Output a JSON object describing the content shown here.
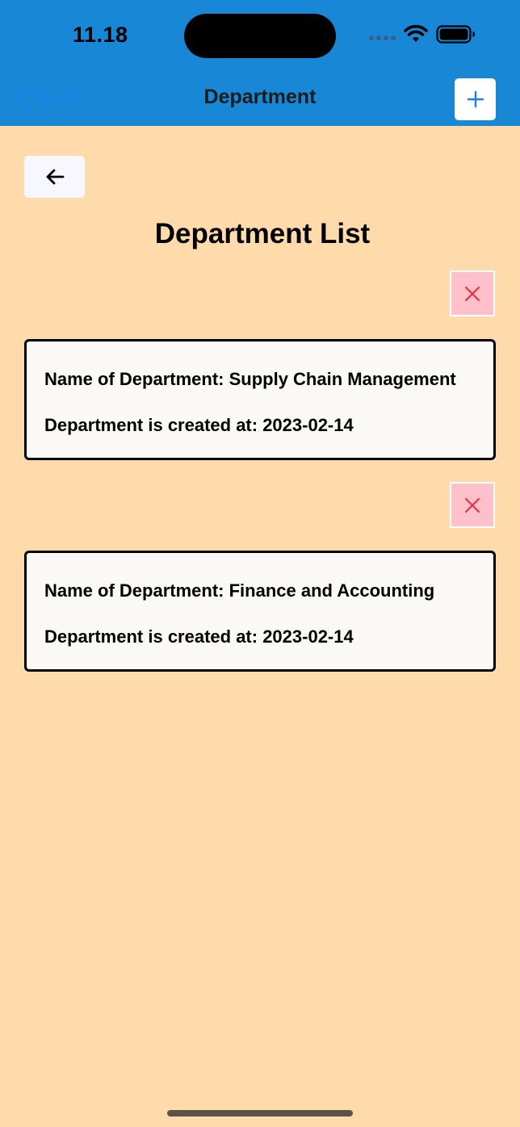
{
  "status_bar": {
    "time": "11.18",
    "icons": [
      "cellular-dots-icon",
      "wifi-icon",
      "battery-icon"
    ]
  },
  "nav": {
    "back_label": "Back",
    "title": "Department",
    "add_icon": "plus-icon"
  },
  "page": {
    "back_icon": "arrow-left-icon",
    "title": "Department List"
  },
  "departments": [
    {
      "name_line": "Name of Department: Supply Chain Management",
      "created_line": "Department is created at: 2023-02-14"
    },
    {
      "name_line": "Name of Department: Finance and Accounting",
      "created_line": "Department is created at: 2023-02-14"
    }
  ],
  "colors": {
    "header": "#1787D6",
    "background": "#FFDAAB",
    "card": "#FAF9F6",
    "delete_button": "#FEC0CB",
    "delete_icon": "#E8323C",
    "link": "#1C7FE8"
  }
}
